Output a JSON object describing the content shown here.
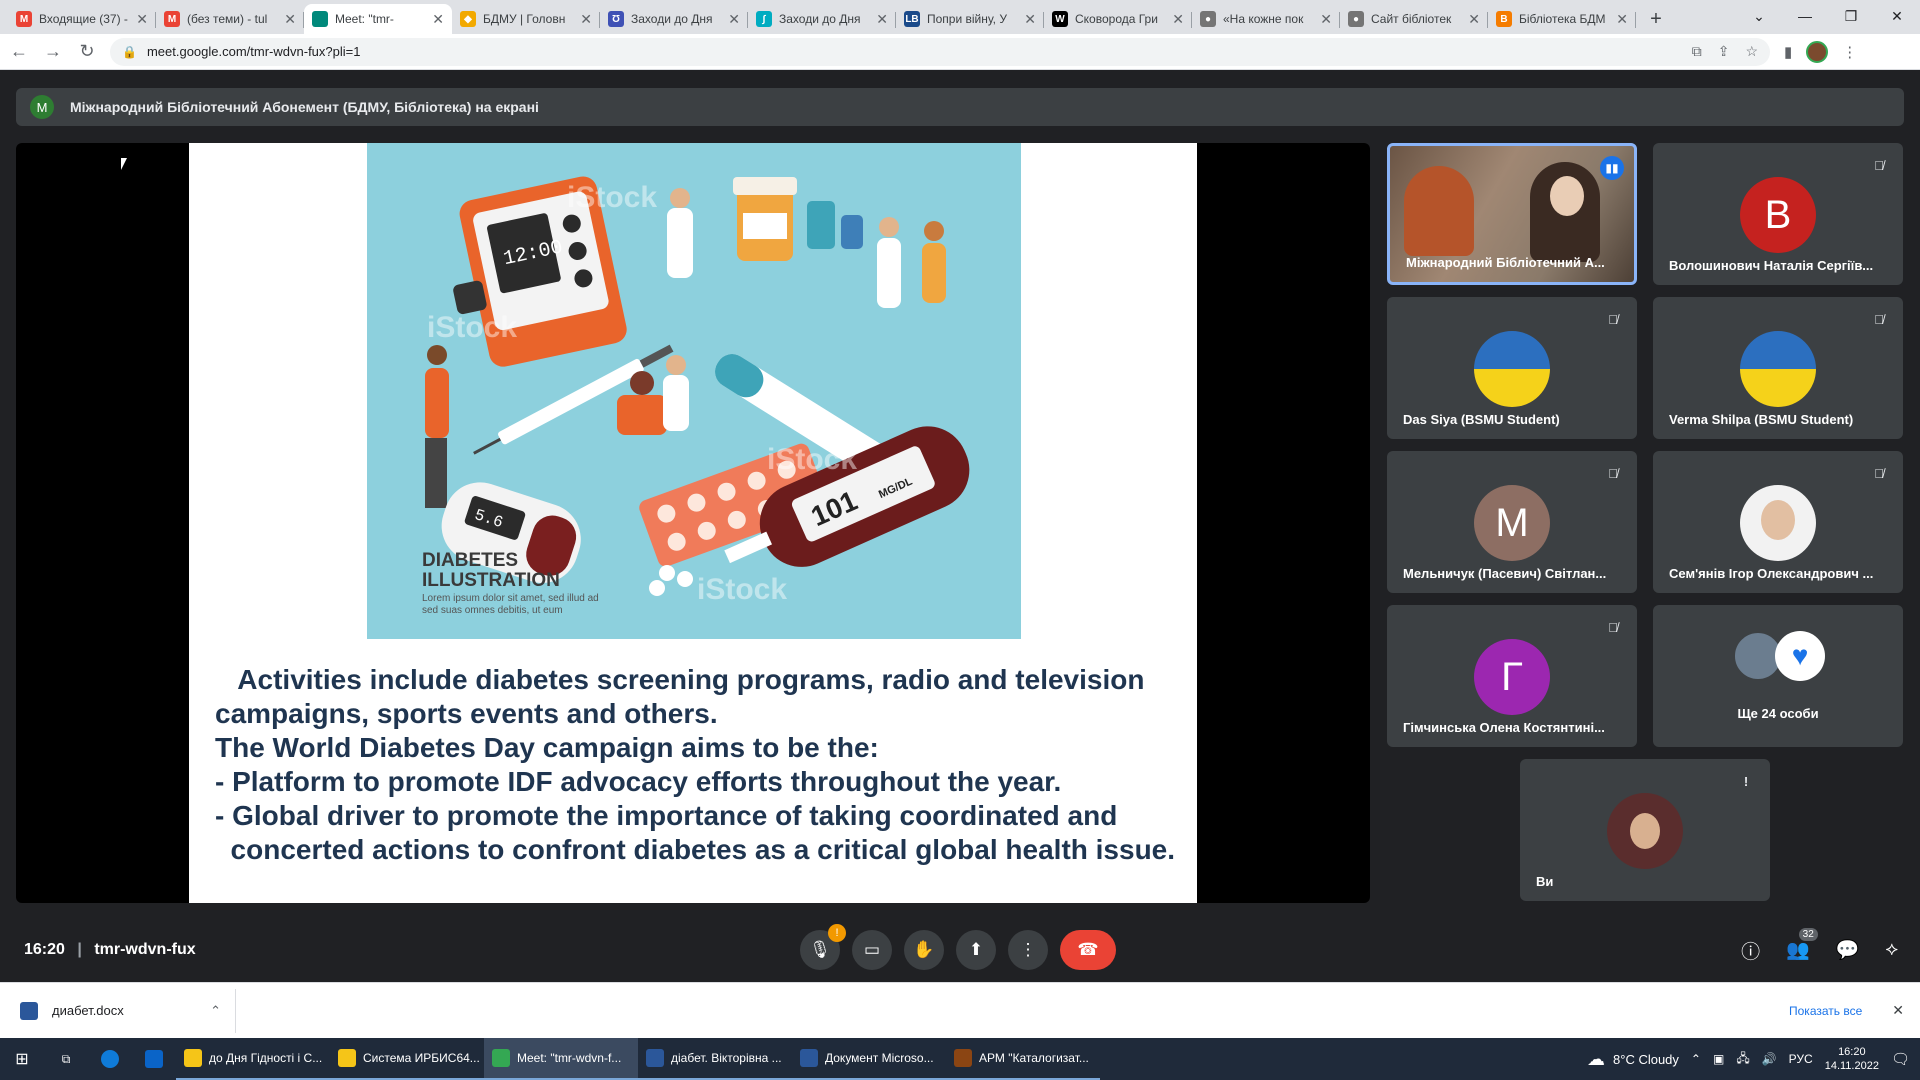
{
  "browser": {
    "tabs": [
      {
        "title": "Входящие (37) -",
        "icon": "gmail-icon",
        "color": "#ea4335",
        "letter": "M"
      },
      {
        "title": "(без теми) - tul",
        "icon": "gmail-icon",
        "color": "#ea4335",
        "letter": "M"
      },
      {
        "title": "Meet: \"tmr-",
        "icon": "meet-icon",
        "color": "#00897b",
        "letter": "",
        "active": true
      },
      {
        "title": "БДМУ | Головн",
        "icon": "bsmu-icon",
        "color": "#f2a900",
        "letter": "◆"
      },
      {
        "title": "Заходи до Дня",
        "icon": "site-icon",
        "color": "#3f51b5",
        "letter": "Ʊ"
      },
      {
        "title": "Заходи до Дня",
        "icon": "feather-icon",
        "color": "#00acc1",
        "letter": "∫"
      },
      {
        "title": "Попри війну, У",
        "icon": "lb-icon",
        "color": "#1a4a8a",
        "letter": "LB"
      },
      {
        "title": "Сковорода Гри",
        "icon": "wikipedia-icon",
        "color": "#000000",
        "letter": "W"
      },
      {
        "title": "«На кожне пок",
        "icon": "globe-icon",
        "color": "#757575",
        "letter": "●"
      },
      {
        "title": "Сайт бібліотек",
        "icon": "globe-icon",
        "color": "#757575",
        "letter": "●"
      },
      {
        "title": "Бібліотека БДМ",
        "icon": "blogger-icon",
        "color": "#f57c00",
        "letter": "B"
      }
    ],
    "url": "meet.google.com/tmr-wdvn-fux?pli=1"
  },
  "meet": {
    "presenter_bar": "Міжнародний Бібліотечний Абонемент (БДМУ, Бібліотека) на екрані",
    "presenter_initial": "M",
    "slide": {
      "caption_title": "DIABETES\nILLUSTRATION",
      "caption_body": "Lorem ipsum dolor sit amet, sed illud ad sed suas omnes debitis, ut eum",
      "watermark": "iStock",
      "lines": [
        "   Activities include diabetes screening programs, radio and television",
        "campaigns, sports events and others.",
        "The World Diabetes Day campaign aims to be the:",
        "- Platform to promote IDF advocacy efforts throughout the year.",
        "- Global driver to promote the importance of taking coordinated and",
        "  concerted actions to confront diabetes as a critical global health issue."
      ],
      "illus_labels": {
        "meter": "12:00",
        "glucometer": "101",
        "glucometer_unit": "MG/DL",
        "small_meter": "5.6"
      }
    },
    "participants": [
      {
        "name": "Міжнародний Бібліотечний А...",
        "type": "video",
        "speaking": true
      },
      {
        "name": "Волошинович Наталія Сергіїв...",
        "type": "initial",
        "initial": "В",
        "color": "#c5221f"
      },
      {
        "name": "Das Siya (BSMU Student)",
        "type": "flag"
      },
      {
        "name": "Verma Shilpa (BSMU Student)",
        "type": "flag"
      },
      {
        "name": "Мельничук (Пасевич) Світлан...",
        "type": "initial",
        "initial": "М",
        "color": "#8d6e63"
      },
      {
        "name": "Сем'янів Ігор Олександрович ...",
        "type": "photo"
      },
      {
        "name": "Гімчинська Олена Костянтині...",
        "type": "initial",
        "initial": "Г",
        "color": "#9c27b0"
      },
      {
        "name": "Ще 24 особи",
        "type": "more"
      }
    ],
    "self_tile": {
      "name": "Ви",
      "alert": "!"
    },
    "time": "16:20",
    "meeting_code": "tmr-wdvn-fux",
    "people_count": "32",
    "mic_warning": "!"
  },
  "download_bar": {
    "file": "диабет.docx",
    "show_all": "Показать все"
  },
  "taskbar": {
    "apps": [
      {
        "label": "до Дня Гідності і С...",
        "color": "#f5c518"
      },
      {
        "label": "Система ИРБИС64...",
        "color": "#f5c518"
      },
      {
        "label": "Meet: \"tmr-wdvn-f...",
        "color": "#34a853",
        "active": true
      },
      {
        "label": "діабет. Вікторівна ...",
        "color": "#2b579a"
      },
      {
        "label": "Документ Microso...",
        "color": "#2b579a"
      },
      {
        "label": "АРМ \"Каталогизат...",
        "color": "#8b4513"
      }
    ],
    "weather": "8°C  Cloudy",
    "lang": "РУС",
    "clock_time": "16:20",
    "clock_date": "14.11.2022"
  }
}
